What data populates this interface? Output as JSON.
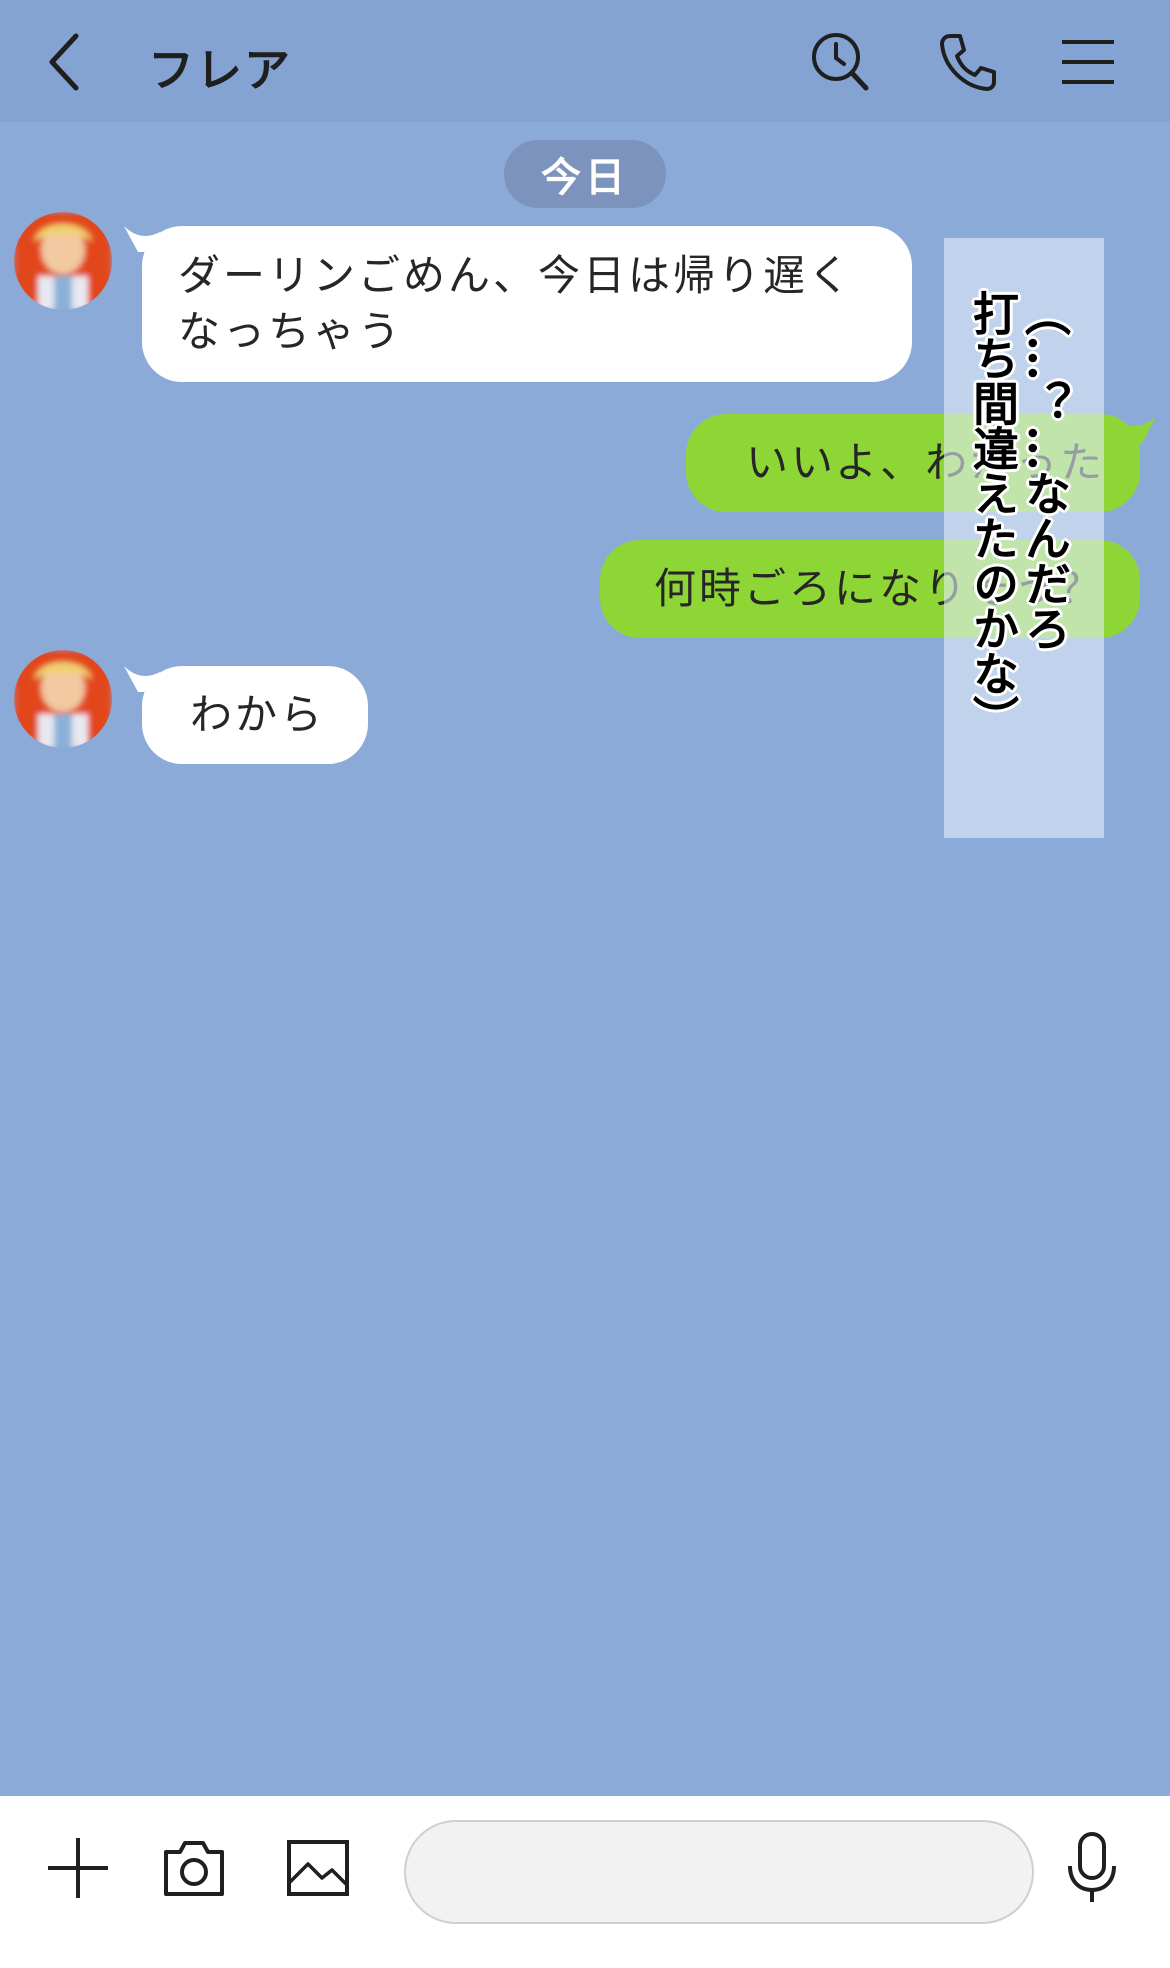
{
  "header": {
    "title": "フレア",
    "icons": [
      "back-icon",
      "search-icon",
      "phone-icon",
      "menu-icon"
    ]
  },
  "date_separator": "今日",
  "messages": [
    {
      "side": "in",
      "line1": "ダーリンごめん、今日は帰り遅く",
      "line2": "なっちゃう"
    },
    {
      "side": "out",
      "text": "いいよ、わかった"
    },
    {
      "side": "out",
      "text": "何時ごろになりそう？"
    },
    {
      "side": "in",
      "text": "わから"
    }
  ],
  "overlay": {
    "line1": "（…？…なんだろ",
    "line2": "打ち間違えたのかな）"
  },
  "footer": {
    "input_value": "",
    "icons": [
      "plus-icon",
      "camera-icon",
      "image-icon",
      "mic-icon"
    ]
  },
  "colors": {
    "chat_background": "#8caad8",
    "header_background": "#84a3d3",
    "incoming_bubble": "#ffffff",
    "outgoing_bubble": "#8ed636",
    "date_pill": "#7b93bd"
  }
}
